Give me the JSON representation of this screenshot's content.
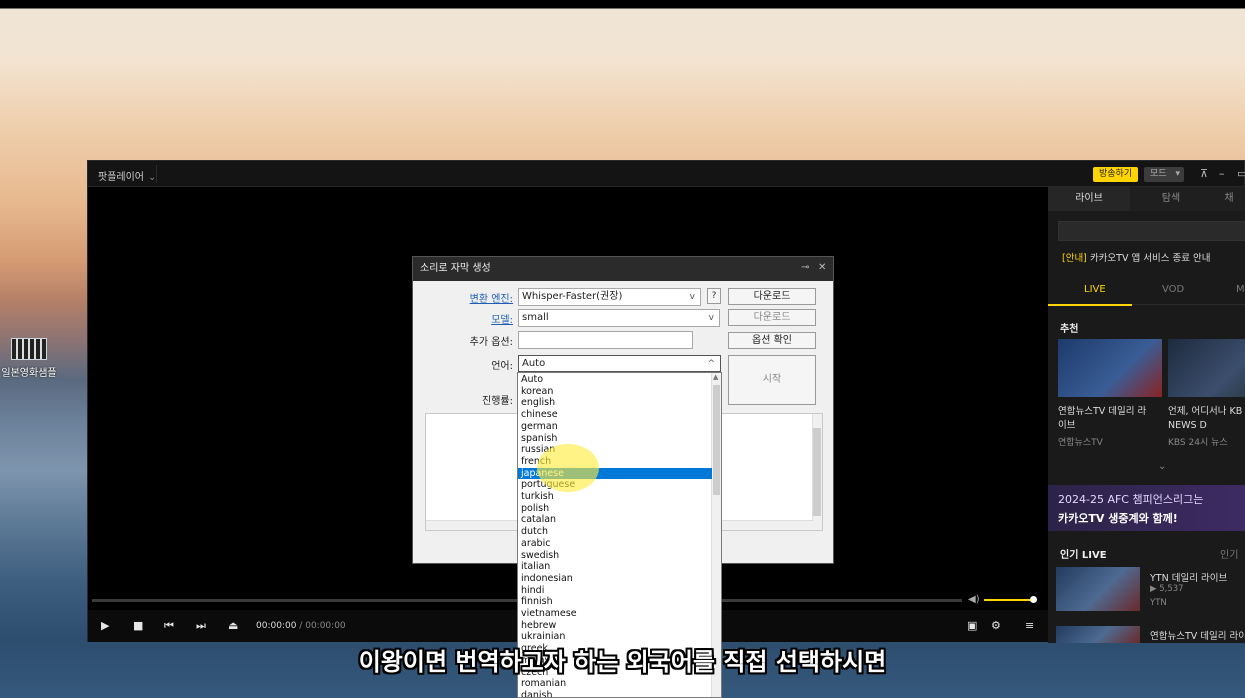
{
  "desktop": {
    "icon_label": "일본영화샘플"
  },
  "player": {
    "app_name": "팟플레이어",
    "broadcast_button": "방송하기",
    "mode_button": "모드",
    "time_current": "00:00:00",
    "time_separator": "/",
    "time_total": "00:00:00",
    "volume_level": 0.9
  },
  "sidebar": {
    "tabs": [
      "라이브",
      "탐색",
      "채"
    ],
    "notice_tag": "[안내]",
    "notice_text": "카카오TV 앱 서비스 종료 안내",
    "subtabs": [
      "LIVE",
      "VOD",
      "M"
    ],
    "recommend_title": "추천",
    "recommend_cards": [
      {
        "title_line1": "연합뉴스TV 데일리 라",
        "title_line2": "이브",
        "channel": "연합뉴스TV"
      },
      {
        "title_line1": "언제, 어디서나 KB",
        "title_line2": "NEWS D",
        "channel": "KBS 24시 뉴스"
      }
    ],
    "banner_line1": "2024-25 AFC 챔피언스리그는",
    "banner_line2": "카카오TV 생중계와 함께!",
    "popular_title": "인기 LIVE",
    "popular_more": "인기",
    "popular_items": [
      {
        "title": "YTN 데일리 라이브",
        "viewers": "▶ 5,537",
        "channel": "YTN"
      },
      {
        "title": "연합뉴스TV 데일리 라이",
        "viewers": "",
        "channel": ""
      }
    ]
  },
  "dialog": {
    "title": "소리로 자막 생성",
    "engine_label": "변환 엔진:",
    "engine_value": "Whisper-Faster(권장)",
    "help_button": "?",
    "download_button_1": "다운로드",
    "model_label": "모델:",
    "model_value": "small",
    "download_button_2": "다운로드",
    "extra_options_label": "추가 옵션:",
    "extra_options_value": "",
    "option_check_button": "옵션 확인",
    "language_label": "언어:",
    "language_value": "Auto",
    "start_button": "시작",
    "progress_label": "진행률:"
  },
  "language_dropdown": {
    "selected": "japanese",
    "options": [
      "Auto",
      "korean",
      "english",
      "chinese",
      "german",
      "spanish",
      "russian",
      "french",
      "japanese",
      "portuguese",
      "turkish",
      "polish",
      "catalan",
      "dutch",
      "arabic",
      "swedish",
      "italian",
      "indonesian",
      "hindi",
      "finnish",
      "vietnamese",
      "hebrew",
      "ukrainian",
      "greek",
      "malay",
      "czech",
      "romanian",
      "danish"
    ]
  },
  "caption": "이왕이면 번역하고자 하는 외국어를 직접 선택하시면",
  "colors": {
    "accent": "#ffd400",
    "selection": "#0078d7",
    "link": "#1e5eb6"
  }
}
